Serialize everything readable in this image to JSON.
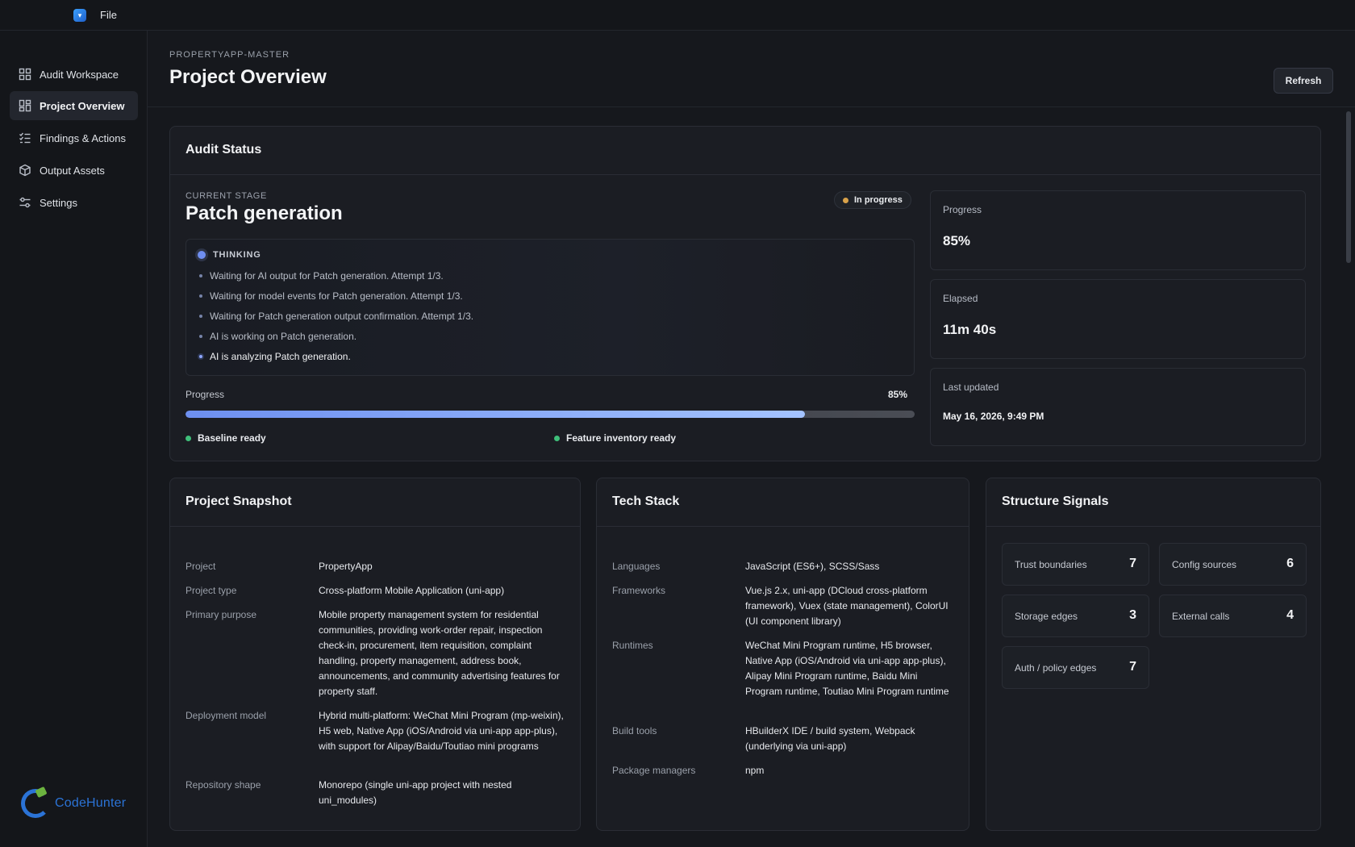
{
  "titlebar": {
    "menu_file": "File"
  },
  "sidebar": {
    "items": [
      {
        "label": "Audit Workspace",
        "icon": "workspace-icon"
      },
      {
        "label": "Project Overview",
        "icon": "overview-grid-icon",
        "active": true
      },
      {
        "label": "Findings & Actions",
        "icon": "checklist-icon"
      },
      {
        "label": "Output Assets",
        "icon": "package-icon"
      },
      {
        "label": "Settings",
        "icon": "sliders-icon"
      }
    ],
    "logo_text": "CodeHunter"
  },
  "header": {
    "breadcrumb": "PROPERTYAPP-MASTER",
    "title": "Project Overview",
    "refresh_label": "Refresh"
  },
  "audit_status": {
    "title": "Audit Status",
    "stage_label": "CURRENT STAGE",
    "stage_name": "Patch generation",
    "status": "In progress",
    "thinking_label": "THINKING",
    "thinking_lines": [
      "Waiting for AI output for Patch generation. Attempt 1/3.",
      "Waiting for model events for Patch generation. Attempt 1/3.",
      "Waiting for Patch generation output confirmation. Attempt 1/3.",
      "AI is working on Patch generation.",
      "AI is analyzing Patch generation."
    ],
    "progress_label": "Progress",
    "progress_text": "85%",
    "progress_value": 0.85,
    "ready_tags": [
      "Baseline ready",
      "Feature inventory ready"
    ],
    "metrics": {
      "progress": {
        "label": "Progress",
        "value": "85%"
      },
      "elapsed": {
        "label": "Elapsed",
        "value": "11m 40s"
      },
      "last_updated": {
        "label": "Last updated",
        "value": "May 16, 2026, 9:49 PM"
      }
    }
  },
  "snapshot": {
    "title": "Project Snapshot",
    "rows": [
      {
        "k": "Project",
        "v": "PropertyApp"
      },
      {
        "k": "Project type",
        "v": "Cross-platform Mobile Application (uni-app)"
      },
      {
        "k": "Primary purpose",
        "v": "Mobile property management system for residential communities, providing work-order repair, inspection check-in, procurement, item requisition, complaint handling, property management, address book, announcements, and community advertising features for property staff."
      },
      {
        "k": "Deployment model",
        "v": "Hybrid multi-platform: WeChat Mini Program (mp-weixin), H5 web, Native App (iOS/Android via uni-app app-plus), with support for Alipay/Baidu/Toutiao mini programs"
      },
      {
        "k": "Repository shape",
        "v": "Monorepo (single uni-app project with nested uni_modules)"
      }
    ]
  },
  "tech_stack": {
    "title": "Tech Stack",
    "rows": [
      {
        "k": "Languages",
        "v": "JavaScript (ES6+), SCSS/Sass"
      },
      {
        "k": "Frameworks",
        "v": "Vue.js 2.x, uni-app (DCloud cross-platform framework), Vuex (state management), ColorUI (UI component library)"
      },
      {
        "k": "Runtimes",
        "v": "WeChat Mini Program runtime, H5 browser, Native App (iOS/Android via uni-app app-plus), Alipay Mini Program runtime, Baidu Mini Program runtime, Toutiao Mini Program runtime"
      },
      {
        "k": "Build tools",
        "v": "HBuilderX IDE / build system, Webpack (underlying via uni-app)"
      },
      {
        "k": "Package managers",
        "v": "npm"
      }
    ]
  },
  "structure_signals": {
    "title": "Structure Signals",
    "items": [
      {
        "label": "Trust boundaries",
        "value": "7"
      },
      {
        "label": "Config sources",
        "value": "6"
      },
      {
        "label": "Storage edges",
        "value": "3"
      },
      {
        "label": "External calls",
        "value": "4"
      },
      {
        "label": "Auth / policy edges",
        "value": "7"
      }
    ]
  }
}
